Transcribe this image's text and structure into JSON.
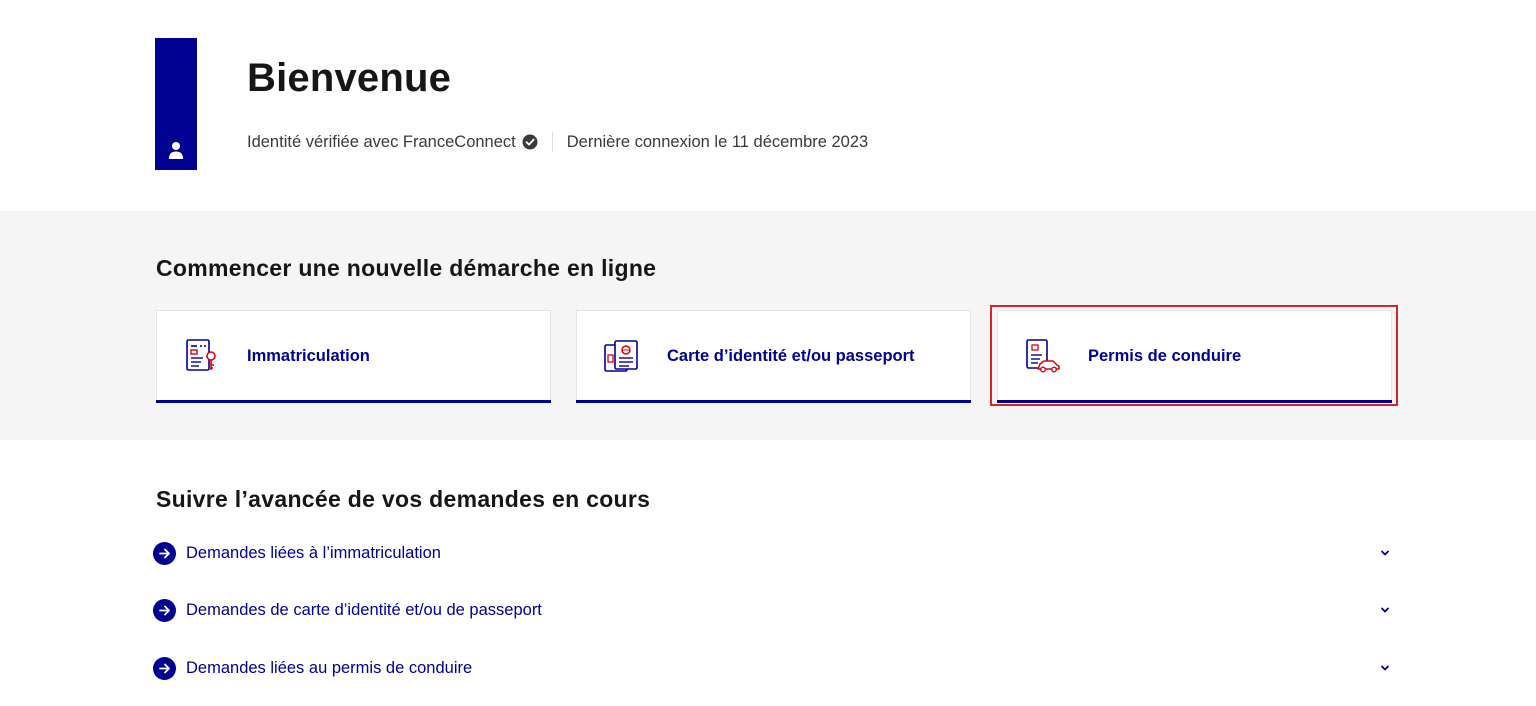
{
  "header": {
    "title": "Bienvenue",
    "identity_text": "Identité vérifiée avec FranceConnect",
    "last_login": "Dernière connexion le 11 décembre 2023",
    "accent_color": "#000091"
  },
  "new_procedure": {
    "title": "Commencer une nouvelle démarche en ligne",
    "cards": [
      {
        "label": "Immatriculation",
        "icon": "vehicle-registration-icon"
      },
      {
        "label": "Carte d’identité et/ou passeport",
        "icon": "id-card-passport-icon"
      },
      {
        "label": "Permis de conduire",
        "icon": "driving-license-icon"
      }
    ],
    "highlight_color": "#d9252a"
  },
  "follow": {
    "title": "Suivre l’avancée de vos demandes en cours",
    "items": [
      {
        "label": "Demandes liées à l’immatriculation"
      },
      {
        "label": "Demandes de carte d’identité et/ou de passeport"
      },
      {
        "label": "Demandes liées au permis de conduire"
      }
    ]
  }
}
